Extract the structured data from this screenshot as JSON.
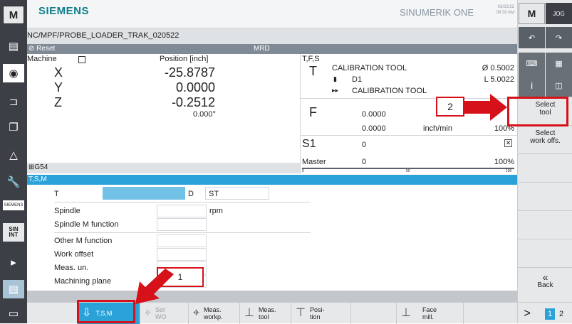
{
  "header": {
    "brand": "SIEMENS",
    "product": "SINUMERIK ONE",
    "date": "03/22/22",
    "time": "08:30 AM"
  },
  "program_path": "NC/MPF/PROBE_LOADER_TRAK_020522",
  "status": {
    "reset": "Reset",
    "mode": "MRD"
  },
  "machine": {
    "title": "Machine",
    "position_header": "Position [inch]",
    "axes": [
      {
        "name": "X",
        "value": "-25.8787"
      },
      {
        "name": "Y",
        "value": "0.0000"
      },
      {
        "name": "Z",
        "value": "-0.2512"
      }
    ],
    "angle": "0.000°",
    "work_offset": "G54"
  },
  "tfs": {
    "title": "T,F,S",
    "t_label": "T",
    "tool_name": "CALIBRATION TOOL",
    "tool_dia": "Ø 0.5002",
    "d_label": "D1",
    "tool_len": "L 5.0022",
    "next_tool": "CALIBRATION TOOL",
    "f_label": "F",
    "f_val1": "0.0000",
    "f_val2": "0.0000",
    "f_unit": "inch/min",
    "f_pct": "100%",
    "s_label": "S1",
    "s_val": "0",
    "master_label": "Master",
    "master_val": "0",
    "master_pct": "100%",
    "scale_0": "0",
    "scale_50": "50",
    "scale_100": "100"
  },
  "tsm": {
    "title": "T,S,M",
    "t_label": "T",
    "d_label": "D",
    "st_label": "ST",
    "spindle": "Spindle",
    "spindle_unit": "rpm",
    "spindle_m": "Spindle M function",
    "other_m": "Other M function",
    "work_offset": "Work offset",
    "meas_units": "Meas. un.",
    "mach_plane": "Machining plane"
  },
  "softkeys": {
    "select_tool": "Select tool",
    "select_wo": "Select work offs.",
    "back": "Back",
    "back_icon": "«",
    "page_next": ">",
    "page1": "1",
    "page2": "2"
  },
  "hsoftkeys": [
    {
      "label": "T,S,M",
      "icon": "tsm-icon"
    },
    {
      "label": "Set WO",
      "icon": "set-wo-icon"
    },
    {
      "label": "Meas. workp.",
      "icon": "meas-workpiece-icon"
    },
    {
      "label": "Meas. tool",
      "icon": "meas-tool-icon"
    },
    {
      "label": "Posi- tion",
      "icon": "position-icon"
    },
    {
      "label": "Face mill.",
      "icon": "face-mill-icon"
    }
  ],
  "callouts": {
    "one": "1",
    "two": "2"
  },
  "left_icons": [
    "M",
    "jog-icon",
    "camera-icon",
    "tool-icon",
    "window-icon",
    "drive-icon",
    "wrench-icon",
    "siemens-icon",
    "sinumerik-icon",
    "arrow-icon",
    "list-icon",
    "screen-icon"
  ],
  "right_top": {
    "m_btn": "M",
    "jog_btn": "JOG"
  },
  "colors": {
    "accent": "#2aa2d8",
    "callout": "#d6111a",
    "brand": "#0c7f8a"
  }
}
